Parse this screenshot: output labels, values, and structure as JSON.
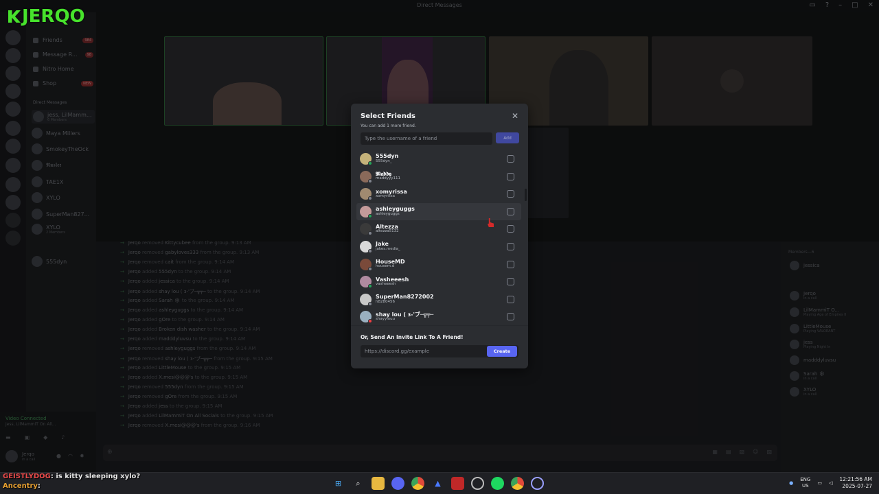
{
  "window": {
    "title": "Direct Messages"
  },
  "stream_logo": "JERQO",
  "sidebar": {
    "items": [
      {
        "label": "Friends",
        "badge": "984"
      },
      {
        "label": "Message R...",
        "badge": "98"
      },
      {
        "label": "Nitro Home",
        "badge": ""
      },
      {
        "label": "Shop",
        "badge": "NEW"
      }
    ],
    "dm_header": "Direct Messages",
    "dms": [
      {
        "name": "jess, LilMamm...",
        "sub": "6 Members"
      },
      {
        "name": "Maya Millers",
        "sub": ""
      },
      {
        "name": "SmokeyTheOck",
        "sub": ""
      },
      {
        "name": "𝕽𝖚𝖘𝖑𝖊𝖗",
        "sub": ""
      },
      {
        "name": "TAE1X",
        "sub": ""
      },
      {
        "name": "XYLO",
        "sub": ""
      },
      {
        "name": "SuperMan827...",
        "sub": ""
      },
      {
        "name": "XYLO",
        "sub": "2 Members"
      },
      {
        "name": "555dyn",
        "sub": ""
      }
    ],
    "voice_status": "Video Connected",
    "voice_sub": "jess, LilMammiT On All...",
    "user_name": "Jerqo",
    "user_status": "in a call"
  },
  "chat": {
    "messages": [
      {
        "actor": "Jerqo",
        "action": "removed",
        "target": "Kittycubee",
        "rest": "from the group. 9:13 AM"
      },
      {
        "actor": "Jerqo",
        "action": "removed",
        "target": "gabyloves333",
        "rest": "from the group. 9:13 AM"
      },
      {
        "actor": "Jerqo",
        "action": "removed",
        "target": "cait",
        "rest": "from the group. 9:14 AM"
      },
      {
        "actor": "Jerqo",
        "action": "added",
        "target": "555dyn",
        "rest": "to the group. 9:14 AM"
      },
      {
        "actor": "Jerqo",
        "action": "added",
        "target": "jessica",
        "rest": "to the group. 9:14 AM"
      },
      {
        "actor": "Jerqo",
        "action": "added",
        "target": "shay lou ( ɜ-'ブ─╦╤─",
        "rest": "to the group. 9:14 AM"
      },
      {
        "actor": "Jerqo",
        "action": "added",
        "target": "Sarah 🕸",
        "rest": "to the group. 9:14 AM"
      },
      {
        "actor": "Jerqo",
        "action": "added",
        "target": "ashleyguggs",
        "rest": "to the group. 9:14 AM"
      },
      {
        "actor": "Jerqo",
        "action": "added",
        "target": "gOre",
        "rest": "to the group. 9:14 AM"
      },
      {
        "actor": "Jerqo",
        "action": "added",
        "target": "Broken dish washer",
        "rest": "to the group. 9:14 AM"
      },
      {
        "actor": "Jerqo",
        "action": "added",
        "target": "madddyluvsu",
        "rest": "to the group. 9:14 AM"
      },
      {
        "actor": "Jerqo",
        "action": "removed",
        "target": "ashleyguggs",
        "rest": "from the group. 9:14 AM"
      },
      {
        "actor": "Jerqo",
        "action": "removed",
        "target": "shay lou ( ɜ-'ブ─╦╤─",
        "rest": "from the group. 9:15 AM"
      },
      {
        "actor": "Jerqo",
        "action": "added",
        "target": "LittleMouse",
        "rest": "to the group. 9:15 AM"
      },
      {
        "actor": "Jerqo",
        "action": "added",
        "target": "X.mesi@@@'s",
        "rest": "to the group. 9:15 AM"
      },
      {
        "actor": "Jerqo",
        "action": "removed",
        "target": "555dyn",
        "rest": "from the group. 9:15 AM"
      },
      {
        "actor": "Jerqo",
        "action": "removed",
        "target": "gOre",
        "rest": "from the group. 9:15 AM"
      },
      {
        "actor": "Jerqo",
        "action": "added",
        "target": "jess",
        "rest": "to the group. 9:15 AM"
      },
      {
        "actor": "Jerqo",
        "action": "added",
        "target": "LilMammiT On All Socials",
        "rest": "to the group. 9:15 AM"
      },
      {
        "actor": "Jerqo",
        "action": "removed",
        "target": "X.mesi@@@'s",
        "rest": "from the group. 9:16 AM"
      }
    ]
  },
  "members": {
    "header": "Members—6",
    "list": [
      {
        "name": "jessica",
        "sub": ""
      },
      {
        "name": "Jerqo",
        "sub": "in a call"
      },
      {
        "name": "LilMammiT O...",
        "sub": "Playing Age of Empires II"
      },
      {
        "name": "LittleMouse",
        "sub": "Playing VALORANT"
      },
      {
        "name": "jess",
        "sub": "Playing Night In"
      },
      {
        "name": "madddyluvsu",
        "sub": ""
      },
      {
        "name": "Sarah 🕸",
        "sub": "in a call"
      },
      {
        "name": "XYLO",
        "sub": "in a call"
      }
    ]
  },
  "modal": {
    "title": "Select Friends",
    "subtitle": "You can add 1 more friend.",
    "search_placeholder": "Type the username of a friend",
    "add_label": "Add",
    "close_glyph": "✕",
    "friends": [
      {
        "display": "555dyn",
        "username": "555dyn_",
        "color": "#c4b27a",
        "status": "#23a55a"
      },
      {
        "display": "𝕸𝖆𝖉𝖉𝖞",
        "username": "maddyyy111",
        "color": "#8a6a5a",
        "status": "#80848e"
      },
      {
        "display": "xomyrissa",
        "username": "xomyrissa",
        "color": "#a08a70",
        "status": "#80848e"
      },
      {
        "display": "ashleyguggs",
        "username": "ashleyguggs",
        "color": "#c49a9a",
        "status": "#23a55a"
      },
      {
        "display": "Altezza",
        "username": "altezza5132",
        "color": "#3a3a3a",
        "status": "#80848e"
      },
      {
        "display": "Jake",
        "username": "jakes.media_",
        "color": "#d9d9d9",
        "status": "#80848e"
      },
      {
        "display": "HouseMD",
        "username": "housem.d",
        "color": "#7a4a3a",
        "status": "#80848e"
      },
      {
        "display": "Vasheeesh",
        "username": "vasheeesh",
        "color": "#b08aa0",
        "status": "#23a55a"
      },
      {
        "display": "SuperMan8272002",
        "username": "h8280456",
        "color": "#c9c9c9",
        "status": "#80848e"
      },
      {
        "display": "shay lou ( ɜ-'ブ─╦╤─",
        "username": "shayylouu",
        "color": "#9ab0c0",
        "status": "#f23f43"
      }
    ],
    "invite_heading": "Or, Send An Invite Link To A Friend!",
    "invite_placeholder": "https://discord.gg/example",
    "create_label": "Create"
  },
  "stream_chat": [
    {
      "user": "GEISTLYDOG",
      "text": ": is kitty sleeping xylo?",
      "color": "#e84a4a"
    },
    {
      "user": "Ancentry",
      "text": ":",
      "color": "#e8a030"
    }
  ],
  "taskbar": {
    "lang_top": "ENG",
    "lang_bottom": "US",
    "time": "12:21:56 AM",
    "date": "2025-07-27"
  }
}
